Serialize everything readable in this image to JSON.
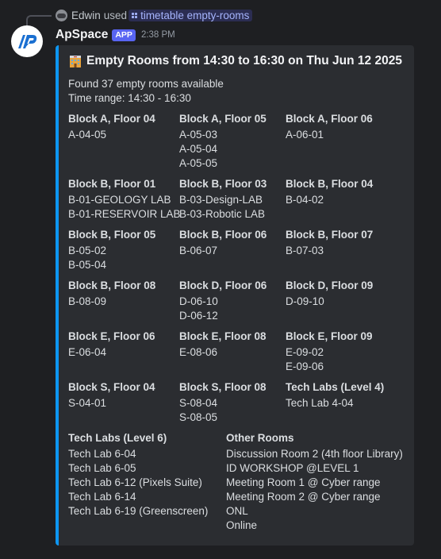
{
  "reply": {
    "user": "Edwin",
    "verb": "used",
    "command": "timetable empty-rooms"
  },
  "message": {
    "author": "ApSpace",
    "badge": "APP",
    "timestamp": "2:38 PM"
  },
  "embed": {
    "accent_color": "#0d96f2",
    "title_icon": "hotel-icon",
    "title": "Empty Rooms from 14:30 to 16:30 on Thu Jun 12 2025",
    "description": [
      "Found 37 empty rooms available",
      "Time range: 14:30 - 16:30"
    ],
    "fields": [
      {
        "name": "Block A, Floor 04",
        "values": [
          "A-04-05"
        ]
      },
      {
        "name": "Block A, Floor 05",
        "values": [
          "A-05-03",
          "A-05-04",
          "A-05-05"
        ]
      },
      {
        "name": "Block A, Floor 06",
        "values": [
          "A-06-01"
        ]
      },
      {
        "name": "Block B, Floor 01",
        "values": [
          "B-01-GEOLOGY LAB",
          "B-01-RESERVOIR LAB"
        ]
      },
      {
        "name": "Block B, Floor 03",
        "values": [
          "B-03-Design-LAB",
          "B-03-Robotic LAB"
        ]
      },
      {
        "name": "Block B, Floor 04",
        "values": [
          "B-04-02"
        ]
      },
      {
        "name": "Block B, Floor 05",
        "values": [
          "B-05-02",
          "B-05-04"
        ]
      },
      {
        "name": "Block B, Floor 06",
        "values": [
          "B-06-07"
        ]
      },
      {
        "name": "Block B, Floor 07",
        "values": [
          "B-07-03"
        ]
      },
      {
        "name": "Block B, Floor 08",
        "values": [
          "B-08-09"
        ]
      },
      {
        "name": "Block D, Floor 06",
        "values": [
          "D-06-10",
          "D-06-12"
        ]
      },
      {
        "name": "Block D, Floor 09",
        "values": [
          "D-09-10"
        ]
      },
      {
        "name": "Block E, Floor 06",
        "values": [
          "E-06-04"
        ]
      },
      {
        "name": "Block E, Floor 08",
        "values": [
          "E-08-06"
        ]
      },
      {
        "name": "Block E, Floor 09",
        "values": [
          "E-09-02",
          "E-09-06"
        ]
      },
      {
        "name": "Block S, Floor 04",
        "values": [
          "S-04-01"
        ]
      },
      {
        "name": "Block S, Floor 08",
        "values": [
          "S-08-04",
          "S-08-05"
        ]
      },
      {
        "name": "Tech Labs (Level 4)",
        "values": [
          "Tech Lab 4-04"
        ]
      },
      {
        "name": "Tech Labs (Level 6)",
        "values": [
          "Tech Lab 6-04",
          "Tech Lab 6-05",
          "Tech Lab 6-12 (Pixels Suite)",
          "Tech Lab 6-14",
          "Tech Lab 6-19 (Greenscreen)"
        ]
      },
      {
        "name": "Other Rooms",
        "values": [
          "Discussion Room 2 (4th floor Library)",
          "ID WORKSHOP @LEVEL 1",
          "Meeting Room 1 @ Cyber range",
          "Meeting Room 2 @ Cyber range",
          "ONL",
          "Online"
        ]
      }
    ]
  }
}
